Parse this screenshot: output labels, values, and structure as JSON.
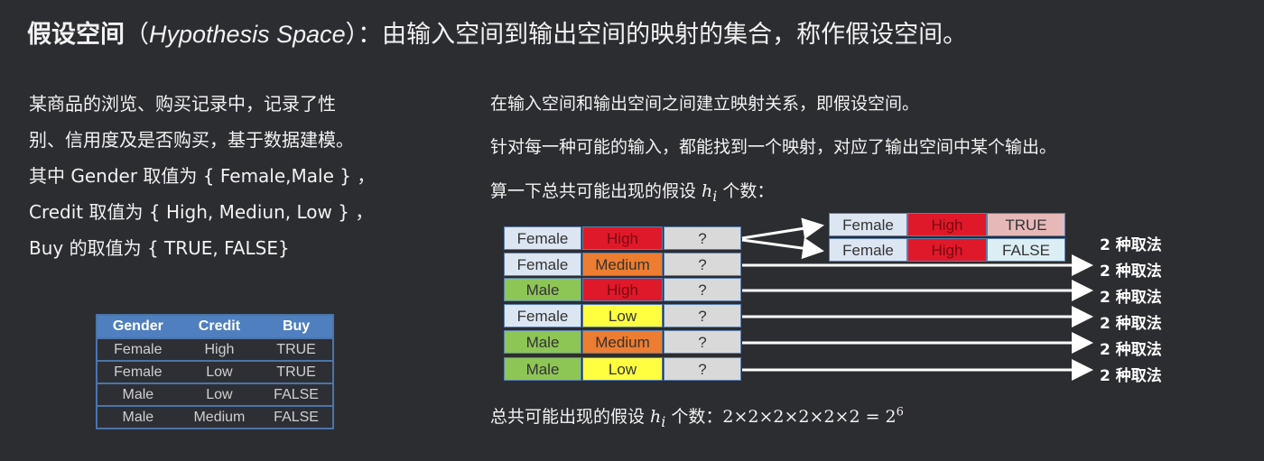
{
  "title": {
    "term": "假设空间",
    "open": "（",
    "english": "Hypothesis Space",
    "close": "）",
    "rest": "：由输入空间到输出空间的映射的集合，称作假设空间。"
  },
  "left_text": [
    "某商品的浏览、购买记录中，记录了性",
    "别、信用度及是否购买，基于数据建模。",
    "其中 Gender 取值为 { Female,Male } ，",
    "Credit 取值为 { High, Mediun, Low } ，",
    "Buy 的取值为 { TRUE, FALSE}"
  ],
  "right_text": {
    "line1": "在输入空间和输出空间之间建立映射关系，即假设空间。",
    "line2": "针对每一种可能的输入，都能找到一个映射，对应了输出空间中某个输出。",
    "line3_pre": "算一下总共可能出现的假设 ",
    "line3_var": "h",
    "line3_sub": "i",
    "line3_post": " 个数："
  },
  "sample_table": {
    "headers": [
      "Gender",
      "Credit",
      "Buy"
    ],
    "rows": [
      [
        "Female",
        "High",
        "TRUE"
      ],
      [
        "Female",
        "Low",
        "TRUE"
      ],
      [
        "Male",
        "Low",
        "FALSE"
      ],
      [
        "Male",
        "Medium",
        "FALSE"
      ]
    ]
  },
  "input_table": {
    "rows": [
      [
        "Female",
        "High",
        "?"
      ],
      [
        "Female",
        "Medium",
        "?"
      ],
      [
        "Male",
        "High",
        "?"
      ],
      [
        "Female",
        "Low",
        "?"
      ],
      [
        "Male",
        "Medium",
        "?"
      ],
      [
        "Male",
        "Low",
        "?"
      ]
    ]
  },
  "branch_table": {
    "rows": [
      [
        "Female",
        "High",
        "TRUE"
      ],
      [
        "Female",
        "High",
        "FALSE"
      ]
    ]
  },
  "count_labels": [
    "2 种取法",
    "2 种取法",
    "2 种取法",
    "2 种取法",
    "2 种取法",
    "2 种取法"
  ],
  "formula": {
    "pre": "总共可能出现的假设 ",
    "var": "h",
    "sub": "i",
    "mid": " 个数：",
    "expr": "2×2×2×2×2×2 = 2",
    "exp": "6"
  },
  "colors": {
    "Female": "#dce6f2",
    "Male": "#8dc654",
    "High": "#e0192a",
    "Medium": "#ed7d31",
    "Low": "#ffff40",
    "?": "#d9d9d9",
    "TRUE": "#e6b9b8",
    "FALSE": "#dbeef4"
  }
}
